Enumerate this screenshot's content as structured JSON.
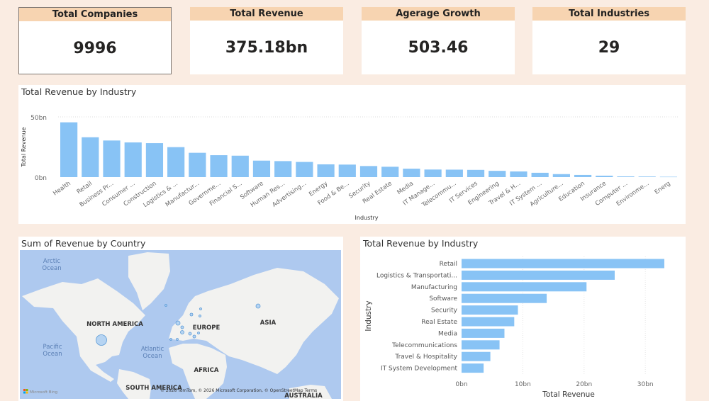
{
  "kpis": [
    {
      "label": "Total Companies",
      "value": "9996"
    },
    {
      "label": "Total Revenue",
      "value": "375.18bn"
    },
    {
      "label": "Agerage Growth",
      "value": "503.46"
    },
    {
      "label": "Total Industries",
      "value": "29"
    }
  ],
  "map": {
    "title": "Sum of Revenue by Country",
    "labels": {
      "arctic": "Arctic",
      "arctic2": "Ocean",
      "pacific": "Pacific",
      "pacific2": "Ocean",
      "atlantic": "Atlantic",
      "atlantic2": "Ocean",
      "na": "NORTH AMERICA",
      "europe": "EUROPE",
      "asia": "ASIA",
      "africa": "AFRICA",
      "sa": "SOUTH AMERICA",
      "australia": "AUSTRALIA"
    },
    "attribution": "© 2026 TomTom, © 2026 Microsoft Corporation, © OpenStreetMap Terms",
    "logo": "Microsoft Bing",
    "land_color": "#f2f2f0",
    "water_color": "#aec9ef",
    "bubble_color": "#9cc8f2"
  },
  "chart_data": [
    {
      "type": "bar",
      "title": "Total Revenue by Industry",
      "xlabel": "Industry",
      "ylabel": "Total Revenue",
      "yticks": [
        "0bn",
        "50bn"
      ],
      "ylim": [
        0,
        50
      ],
      "unit": "bn",
      "color": "#88c3f5",
      "grid": true,
      "categories": [
        "Health",
        "Retail",
        "Business Pr...",
        "Consumer ...",
        "Construction",
        "Logistics & ...",
        "Manufactur...",
        "Governme...",
        "Financial S...",
        "Software",
        "Human Res...",
        "Advertising...",
        "Energy",
        "Food & Be...",
        "Security",
        "Real Estate",
        "Media",
        "IT Manage...",
        "Telecommu...",
        "IT Services",
        "Engineering",
        "Travel & H...",
        "IT System ...",
        "Agriculture...",
        "Education",
        "Insurance",
        "Computer ...",
        "Environme...",
        "Energ"
      ],
      "values": [
        45.5,
        33.1,
        30.4,
        28.8,
        28.2,
        24.9,
        20.2,
        18.2,
        17.8,
        13.7,
        13.3,
        12.6,
        10.6,
        10.4,
        9.2,
        8.6,
        7.0,
        6.3,
        6.2,
        6.0,
        5.2,
        4.7,
        3.6,
        2.5,
        1.8,
        1.2,
        0.6,
        0.5,
        0.3
      ]
    },
    {
      "type": "bar",
      "orientation": "horizontal",
      "title": "Total Revenue by Industry",
      "xlabel": "Total Revenue",
      "ylabel": "Industry",
      "xticks": [
        "0bn",
        "10bn",
        "20bn",
        "30bn"
      ],
      "xlim": [
        0,
        35
      ],
      "color": "#88c3f5",
      "grid": true,
      "categories": [
        "Retail",
        "Logistics & Transportati...",
        "Manufacturing",
        "Software",
        "Security",
        "Real Estate",
        "Media",
        "Telecommunications",
        "Travel & Hospitality",
        "IT System Development"
      ],
      "values": [
        33.1,
        25.0,
        20.4,
        13.9,
        9.2,
        8.6,
        7.0,
        6.2,
        4.7,
        3.6
      ]
    }
  ]
}
